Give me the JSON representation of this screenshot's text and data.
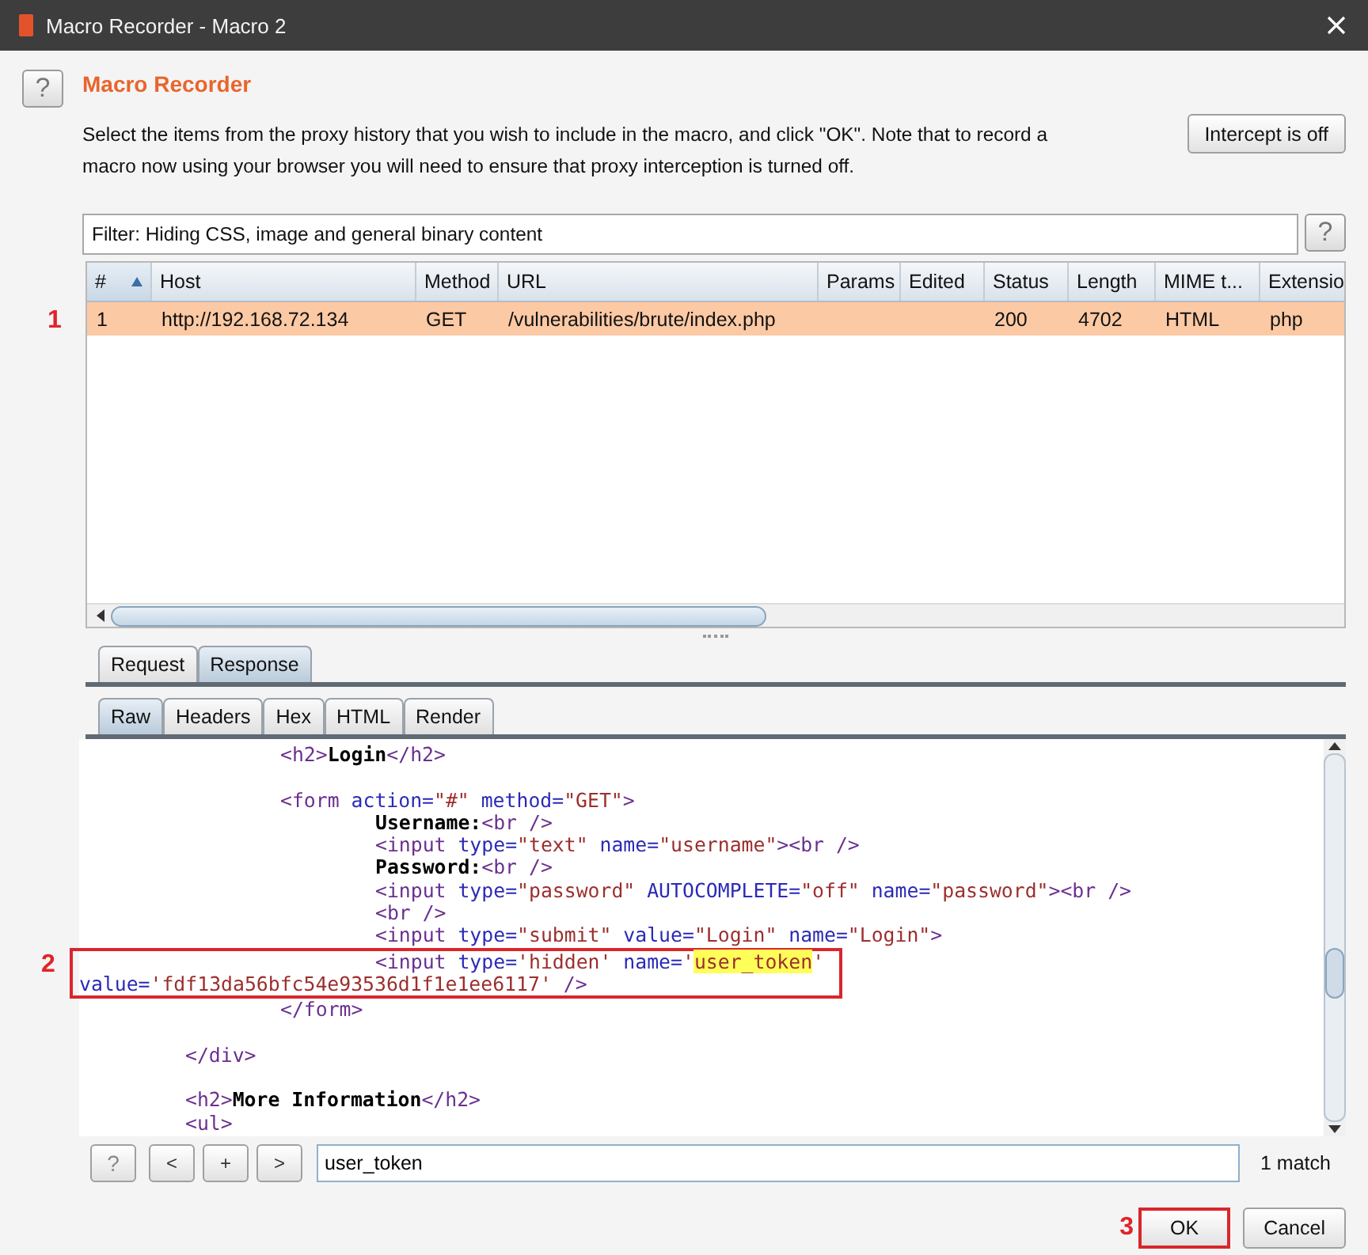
{
  "window": {
    "title": "Macro Recorder - Macro 2"
  },
  "header": {
    "help_button": "?",
    "title": "Macro Recorder",
    "description": "Select the items from the proxy history that you wish to include in the macro, and click \"OK\". Note that to record a macro now using your browser you will need to ensure that proxy interception is turned off."
  },
  "intercept_button": "Intercept is off",
  "filter": {
    "text": "Filter: Hiding CSS, image and general binary content",
    "help_button": "?"
  },
  "table": {
    "columns": [
      {
        "label": "#",
        "sorted": true
      },
      {
        "label": "Host",
        "sorted": false
      },
      {
        "label": "Method",
        "sorted": false
      },
      {
        "label": "URL",
        "sorted": false
      },
      {
        "label": "Params",
        "sorted": false
      },
      {
        "label": "Edited",
        "sorted": false
      },
      {
        "label": "Status",
        "sorted": false
      },
      {
        "label": "Length",
        "sorted": false
      },
      {
        "label": "MIME t...",
        "sorted": false
      },
      {
        "label": "Extensio",
        "sorted": false
      }
    ],
    "rows": [
      {
        "selected": true,
        "marker": "1",
        "cells": [
          "1",
          "http://192.168.72.134",
          "GET",
          "/vulnerabilities/brute/index.php",
          "",
          "",
          "200",
          "4702",
          "HTML",
          "php"
        ]
      }
    ]
  },
  "tabs": [
    {
      "label": "Request",
      "selected": false
    },
    {
      "label": "Response",
      "selected": true
    }
  ],
  "view_tabs": [
    {
      "label": "Raw",
      "selected": true
    },
    {
      "label": "Headers",
      "selected": false
    },
    {
      "label": "Hex",
      "selected": false
    },
    {
      "label": "HTML",
      "selected": false
    },
    {
      "label": "Render",
      "selected": false
    }
  ],
  "code": {
    "callout": "2",
    "lines": [
      {
        "kind": "mid",
        "boxed": false,
        "segments": [
          {
            "kind": "tag",
            "t": "<h2>"
          },
          {
            "kind": "text",
            "t": "Login"
          },
          {
            "kind": "tag",
            "t": "</h2>"
          }
        ]
      },
      {
        "kind": "blank",
        "boxed": false
      },
      {
        "kind": "mid",
        "boxed": false,
        "segments": [
          {
            "kind": "tag",
            "t": "<form"
          },
          {
            "kind": "attr",
            "t": " action="
          },
          {
            "kind": "val",
            "t": "\"#\""
          },
          {
            "kind": "attr",
            "t": " method="
          },
          {
            "kind": "val",
            "t": "\"GET\""
          },
          {
            "kind": "tag",
            "t": ">"
          }
        ]
      },
      {
        "kind": "deep",
        "boxed": false,
        "segments": [
          {
            "kind": "text",
            "t": "Username:"
          },
          {
            "kind": "tag",
            "t": "<br />"
          }
        ]
      },
      {
        "kind": "deep",
        "boxed": false,
        "segments": [
          {
            "kind": "tag",
            "t": "<input"
          },
          {
            "kind": "attr",
            "t": " type="
          },
          {
            "kind": "val",
            "t": "\"text\""
          },
          {
            "kind": "attr",
            "t": " name="
          },
          {
            "kind": "val",
            "t": "\"username\""
          },
          {
            "kind": "tag",
            "t": "><br />"
          }
        ]
      },
      {
        "kind": "deep",
        "boxed": false,
        "segments": [
          {
            "kind": "text",
            "t": "Password:"
          },
          {
            "kind": "tag",
            "t": "<br />"
          }
        ]
      },
      {
        "kind": "deep",
        "boxed": false,
        "segments": [
          {
            "kind": "tag",
            "t": "<input"
          },
          {
            "kind": "attr",
            "t": " type="
          },
          {
            "kind": "val",
            "t": "\"password\""
          },
          {
            "kind": "attr",
            "t": " AUTOCOMPLETE="
          },
          {
            "kind": "val",
            "t": "\"off\""
          },
          {
            "kind": "attr",
            "t": " name="
          },
          {
            "kind": "val",
            "t": "\"password\""
          },
          {
            "kind": "tag",
            "t": "><br />"
          }
        ]
      },
      {
        "kind": "deep",
        "boxed": false,
        "segments": [
          {
            "kind": "tag",
            "t": "<br />"
          }
        ]
      },
      {
        "kind": "deep",
        "boxed": false,
        "segments": [
          {
            "kind": "tag",
            "t": "<input"
          },
          {
            "kind": "attr",
            "t": " type="
          },
          {
            "kind": "val",
            "t": "\"submit\""
          },
          {
            "kind": "attr",
            "t": " value="
          },
          {
            "kind": "val",
            "t": "\"Login\""
          },
          {
            "kind": "attr",
            "t": " name="
          },
          {
            "kind": "val",
            "t": "\"Login\""
          },
          {
            "kind": "tag",
            "t": ">"
          }
        ]
      },
      {
        "kind": "deep",
        "boxed": true,
        "segments": [
          {
            "kind": "tag",
            "t": "<input"
          },
          {
            "kind": "attr",
            "t": " type="
          },
          {
            "kind": "val",
            "t": "'hidden'"
          },
          {
            "kind": "attr",
            "t": " name="
          },
          {
            "kind": "val",
            "t": "'"
          },
          {
            "kind": "match",
            "t": "user_token"
          },
          {
            "kind": "val",
            "t": "'"
          }
        ]
      },
      {
        "kind": "flush",
        "boxed": true,
        "segments": [
          {
            "kind": "attr",
            "t": "value="
          },
          {
            "kind": "val",
            "t": "'fdf13da56bfc54e93536d1f1e1ee6117'"
          },
          {
            "kind": "tag",
            "t": " />"
          }
        ]
      },
      {
        "kind": "mid",
        "boxed": false,
        "segments": [
          {
            "kind": "tag",
            "t": "</form>"
          }
        ]
      },
      {
        "kind": "blank",
        "boxed": false
      },
      {
        "kind": "shallow",
        "boxed": false,
        "segments": [
          {
            "kind": "tag",
            "t": "</div>"
          }
        ]
      },
      {
        "kind": "blank",
        "boxed": false
      },
      {
        "kind": "shallow",
        "boxed": false,
        "segments": [
          {
            "kind": "tag",
            "t": "<h2>"
          },
          {
            "kind": "text",
            "t": "More Information"
          },
          {
            "kind": "tag",
            "t": "</h2>"
          }
        ]
      },
      {
        "kind": "shallow",
        "boxed": false,
        "segments": [
          {
            "kind": "tag",
            "t": "<ul>"
          }
        ]
      }
    ]
  },
  "search": {
    "buttons": [
      "?",
      "<",
      "+",
      ">"
    ],
    "value": "user_token",
    "result": "1 match"
  },
  "buttons": [
    {
      "label": "OK",
      "marker": "3"
    },
    {
      "label": "Cancel"
    }
  ]
}
